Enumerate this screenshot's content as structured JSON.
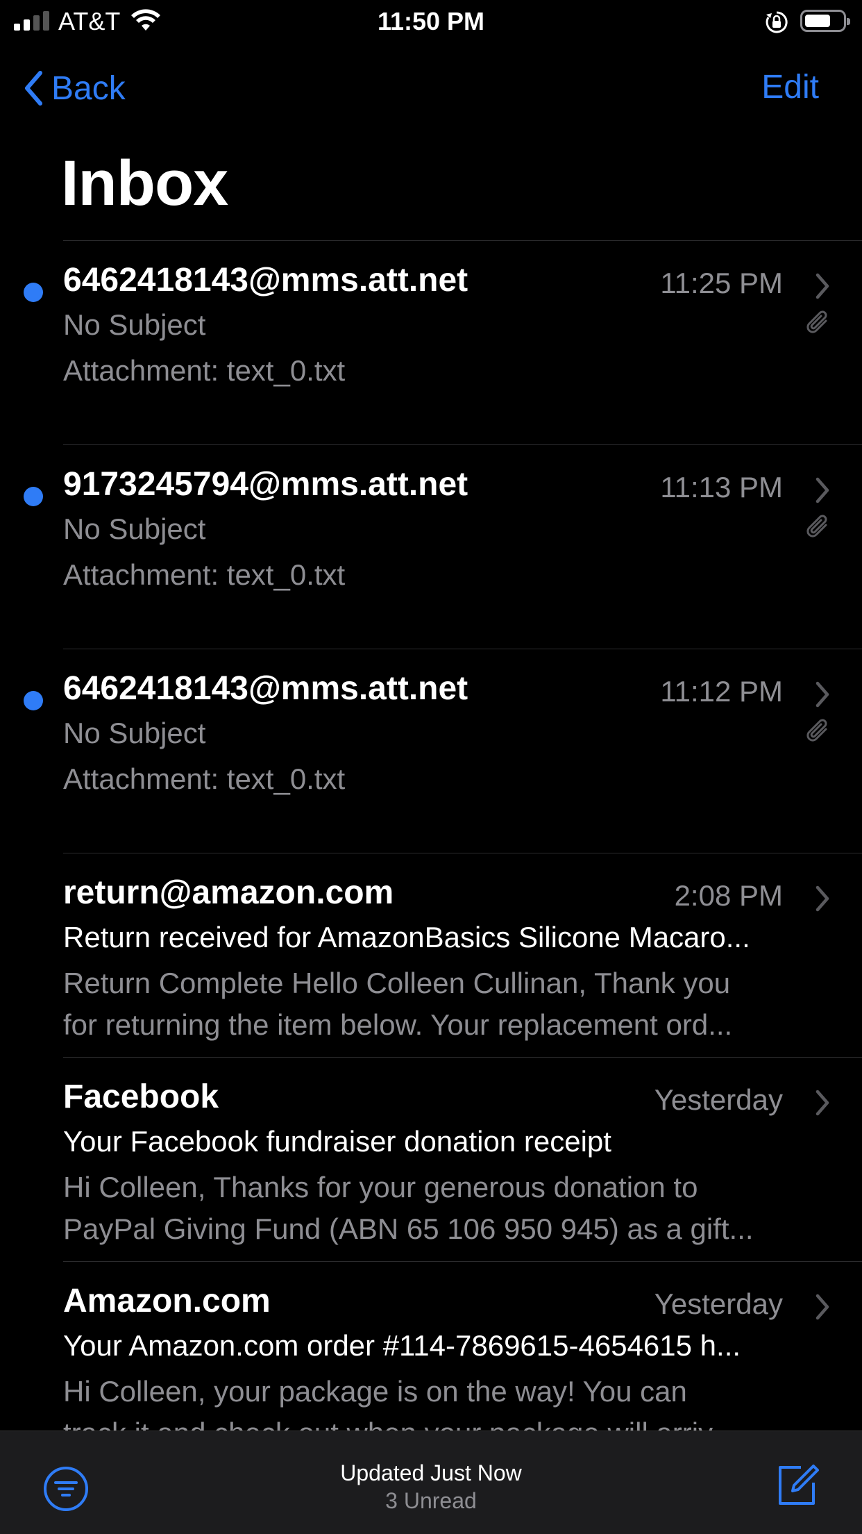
{
  "status_bar": {
    "carrier": "AT&T",
    "time": "11:50 PM",
    "icons": [
      "cellular-signal-icon",
      "wifi-icon",
      "rotation-lock-icon",
      "battery-icon"
    ]
  },
  "nav": {
    "back_label": "Back",
    "edit_label": "Edit",
    "title": "Inbox"
  },
  "messages": [
    {
      "sender": "6462418143@mms.att.net",
      "time": "11:25 PM",
      "subject": "No Subject",
      "preview": [
        "Attachment: text_0.txt"
      ],
      "unread": true,
      "has_attachment": true
    },
    {
      "sender": "9173245794@mms.att.net",
      "time": "11:13 PM",
      "subject": "No Subject",
      "preview": [
        "Attachment: text_0.txt"
      ],
      "unread": true,
      "has_attachment": true
    },
    {
      "sender": "6462418143@mms.att.net",
      "time": "11:12 PM",
      "subject": "No Subject",
      "preview": [
        "Attachment: text_0.txt"
      ],
      "unread": true,
      "has_attachment": true
    },
    {
      "sender": "return@amazon.com",
      "time": "2:08 PM",
      "subject": "Return received for AmazonBasics Silicone Macaro...",
      "preview": [
        "Return Complete Hello Colleen Cullinan, Thank you",
        "for returning the item below. Your replacement ord..."
      ],
      "unread": false,
      "has_attachment": false
    },
    {
      "sender": "Facebook",
      "time": "Yesterday",
      "subject": "Your Facebook fundraiser donation receipt",
      "preview": [
        "Hi Colleen, Thanks for your generous donation to",
        "PayPal Giving Fund (ABN 65 106 950 945) as a gift..."
      ],
      "unread": false,
      "has_attachment": false
    },
    {
      "sender": "Amazon.com",
      "time": "Yesterday",
      "subject": "Your Amazon.com order #114-7869615-4654615 h...",
      "preview": [
        "Hi Colleen, your package is on the way! You can",
        "track it and check out when your package will arriv..."
      ],
      "unread": false,
      "has_attachment": false
    }
  ],
  "toolbar": {
    "status_line1": "Updated Just Now",
    "status_line2": "3 Unread"
  },
  "colors": {
    "accent": "#2f7cf6",
    "secondary_text": "#8e8e93",
    "background": "#000000",
    "toolbar_bg": "#1c1c1e"
  }
}
